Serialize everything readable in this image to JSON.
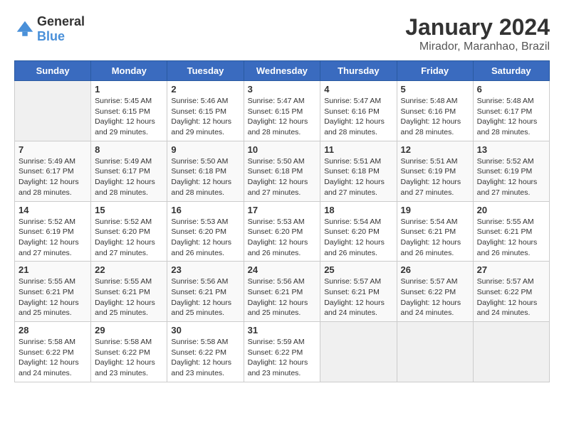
{
  "header": {
    "logo_general": "General",
    "logo_blue": "Blue",
    "title": "January 2024",
    "subtitle": "Mirador, Maranhao, Brazil"
  },
  "days_of_week": [
    "Sunday",
    "Monday",
    "Tuesday",
    "Wednesday",
    "Thursday",
    "Friday",
    "Saturday"
  ],
  "weeks": [
    [
      {
        "day": "",
        "info": ""
      },
      {
        "day": "1",
        "info": "Sunrise: 5:45 AM\nSunset: 6:15 PM\nDaylight: 12 hours\nand 29 minutes."
      },
      {
        "day": "2",
        "info": "Sunrise: 5:46 AM\nSunset: 6:15 PM\nDaylight: 12 hours\nand 29 minutes."
      },
      {
        "day": "3",
        "info": "Sunrise: 5:47 AM\nSunset: 6:15 PM\nDaylight: 12 hours\nand 28 minutes."
      },
      {
        "day": "4",
        "info": "Sunrise: 5:47 AM\nSunset: 6:16 PM\nDaylight: 12 hours\nand 28 minutes."
      },
      {
        "day": "5",
        "info": "Sunrise: 5:48 AM\nSunset: 6:16 PM\nDaylight: 12 hours\nand 28 minutes."
      },
      {
        "day": "6",
        "info": "Sunrise: 5:48 AM\nSunset: 6:17 PM\nDaylight: 12 hours\nand 28 minutes."
      }
    ],
    [
      {
        "day": "7",
        "info": "Sunrise: 5:49 AM\nSunset: 6:17 PM\nDaylight: 12 hours\nand 28 minutes."
      },
      {
        "day": "8",
        "info": "Sunrise: 5:49 AM\nSunset: 6:17 PM\nDaylight: 12 hours\nand 28 minutes."
      },
      {
        "day": "9",
        "info": "Sunrise: 5:50 AM\nSunset: 6:18 PM\nDaylight: 12 hours\nand 28 minutes."
      },
      {
        "day": "10",
        "info": "Sunrise: 5:50 AM\nSunset: 6:18 PM\nDaylight: 12 hours\nand 27 minutes."
      },
      {
        "day": "11",
        "info": "Sunrise: 5:51 AM\nSunset: 6:18 PM\nDaylight: 12 hours\nand 27 minutes."
      },
      {
        "day": "12",
        "info": "Sunrise: 5:51 AM\nSunset: 6:19 PM\nDaylight: 12 hours\nand 27 minutes."
      },
      {
        "day": "13",
        "info": "Sunrise: 5:52 AM\nSunset: 6:19 PM\nDaylight: 12 hours\nand 27 minutes."
      }
    ],
    [
      {
        "day": "14",
        "info": "Sunrise: 5:52 AM\nSunset: 6:19 PM\nDaylight: 12 hours\nand 27 minutes."
      },
      {
        "day": "15",
        "info": "Sunrise: 5:52 AM\nSunset: 6:20 PM\nDaylight: 12 hours\nand 27 minutes."
      },
      {
        "day": "16",
        "info": "Sunrise: 5:53 AM\nSunset: 6:20 PM\nDaylight: 12 hours\nand 26 minutes."
      },
      {
        "day": "17",
        "info": "Sunrise: 5:53 AM\nSunset: 6:20 PM\nDaylight: 12 hours\nand 26 minutes."
      },
      {
        "day": "18",
        "info": "Sunrise: 5:54 AM\nSunset: 6:20 PM\nDaylight: 12 hours\nand 26 minutes."
      },
      {
        "day": "19",
        "info": "Sunrise: 5:54 AM\nSunset: 6:21 PM\nDaylight: 12 hours\nand 26 minutes."
      },
      {
        "day": "20",
        "info": "Sunrise: 5:55 AM\nSunset: 6:21 PM\nDaylight: 12 hours\nand 26 minutes."
      }
    ],
    [
      {
        "day": "21",
        "info": "Sunrise: 5:55 AM\nSunset: 6:21 PM\nDaylight: 12 hours\nand 25 minutes."
      },
      {
        "day": "22",
        "info": "Sunrise: 5:55 AM\nSunset: 6:21 PM\nDaylight: 12 hours\nand 25 minutes."
      },
      {
        "day": "23",
        "info": "Sunrise: 5:56 AM\nSunset: 6:21 PM\nDaylight: 12 hours\nand 25 minutes."
      },
      {
        "day": "24",
        "info": "Sunrise: 5:56 AM\nSunset: 6:21 PM\nDaylight: 12 hours\nand 25 minutes."
      },
      {
        "day": "25",
        "info": "Sunrise: 5:57 AM\nSunset: 6:21 PM\nDaylight: 12 hours\nand 24 minutes."
      },
      {
        "day": "26",
        "info": "Sunrise: 5:57 AM\nSunset: 6:22 PM\nDaylight: 12 hours\nand 24 minutes."
      },
      {
        "day": "27",
        "info": "Sunrise: 5:57 AM\nSunset: 6:22 PM\nDaylight: 12 hours\nand 24 minutes."
      }
    ],
    [
      {
        "day": "28",
        "info": "Sunrise: 5:58 AM\nSunset: 6:22 PM\nDaylight: 12 hours\nand 24 minutes."
      },
      {
        "day": "29",
        "info": "Sunrise: 5:58 AM\nSunset: 6:22 PM\nDaylight: 12 hours\nand 23 minutes."
      },
      {
        "day": "30",
        "info": "Sunrise: 5:58 AM\nSunset: 6:22 PM\nDaylight: 12 hours\nand 23 minutes."
      },
      {
        "day": "31",
        "info": "Sunrise: 5:59 AM\nSunset: 6:22 PM\nDaylight: 12 hours\nand 23 minutes."
      },
      {
        "day": "",
        "info": ""
      },
      {
        "day": "",
        "info": ""
      },
      {
        "day": "",
        "info": ""
      }
    ]
  ]
}
